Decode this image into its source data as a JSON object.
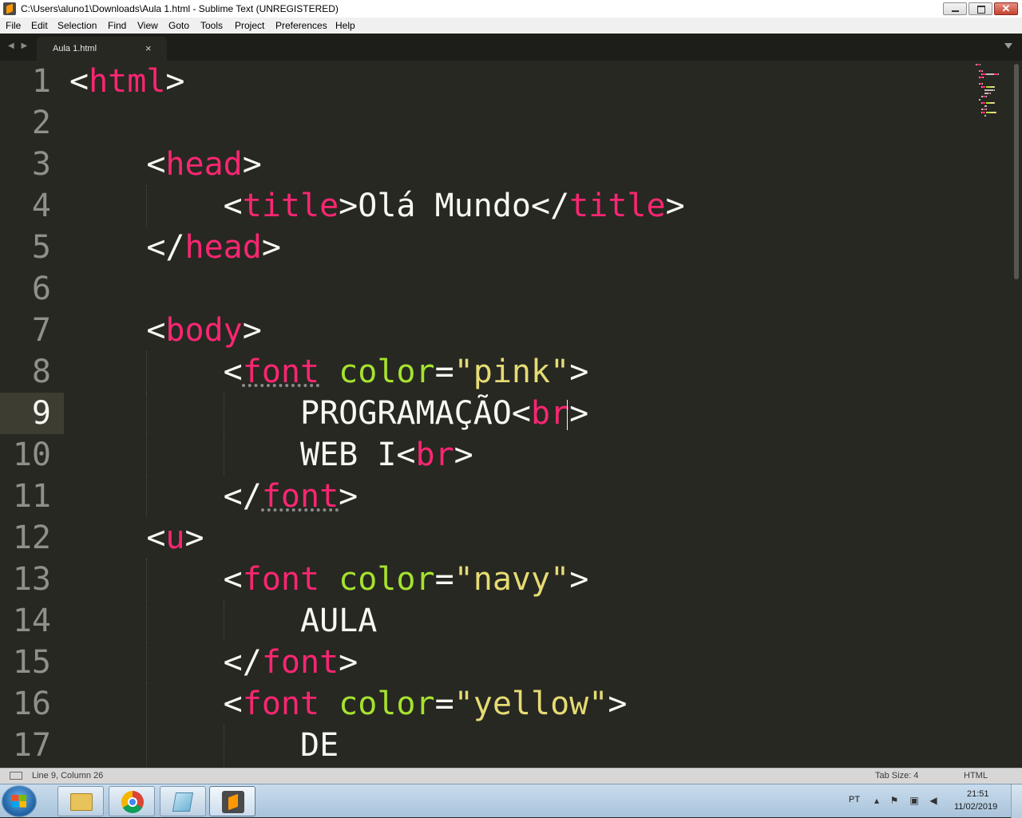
{
  "window": {
    "title": "C:\\Users\\aluno1\\Downloads\\Aula 1.html - Sublime Text (UNREGISTERED)",
    "close_glyph": "✕"
  },
  "menu": [
    "File",
    "Edit",
    "Selection",
    "Find",
    "View",
    "Goto",
    "Tools",
    "Project",
    "Preferences",
    "Help"
  ],
  "tabs": {
    "nav_arrows": "◀ ▶",
    "active": {
      "label": "Aula 1.html",
      "close_glyph": "×"
    }
  },
  "editor": {
    "line_numbers": [
      "1",
      "2",
      "3",
      "4",
      "5",
      "6",
      "7",
      "8",
      "9",
      "10",
      "11",
      "12",
      "13",
      "14",
      "15",
      "16",
      "17"
    ],
    "current_line": 9,
    "colors": {
      "background": "#272822",
      "tag": "#f92672",
      "attribute": "#a6e22e",
      "string": "#e6db74",
      "text": "#f8f8f2",
      "gutter": "#8f908a"
    },
    "lines": [
      [
        {
          "t": "<",
          "c": "p"
        },
        {
          "t": "html",
          "c": "tag"
        },
        {
          "t": ">",
          "c": "p"
        }
      ],
      [],
      [
        {
          "t": "    <",
          "c": "p"
        },
        {
          "t": "head",
          "c": "tag"
        },
        {
          "t": ">",
          "c": "p"
        }
      ],
      [
        {
          "t": "        <",
          "c": "p"
        },
        {
          "t": "title",
          "c": "tag"
        },
        {
          "t": ">Olá Mundo</",
          "c": "p"
        },
        {
          "t": "title",
          "c": "tag"
        },
        {
          "t": ">",
          "c": "p"
        }
      ],
      [
        {
          "t": "    </",
          "c": "p"
        },
        {
          "t": "head",
          "c": "tag"
        },
        {
          "t": ">",
          "c": "p"
        }
      ],
      [],
      [
        {
          "t": "    <",
          "c": "p"
        },
        {
          "t": "body",
          "c": "tag"
        },
        {
          "t": ">",
          "c": "p"
        }
      ],
      [
        {
          "t": "        <",
          "c": "p"
        },
        {
          "t": "font",
          "c": "tag ul"
        },
        {
          "t": " ",
          "c": "p"
        },
        {
          "t": "color",
          "c": "attr"
        },
        {
          "t": "=",
          "c": "p"
        },
        {
          "t": "\"pink\"",
          "c": "str"
        },
        {
          "t": ">",
          "c": "p"
        }
      ],
      [
        {
          "t": "            PROGRAMAÇÃO<",
          "c": "p"
        },
        {
          "t": "br",
          "c": "tag"
        },
        {
          "t": ">",
          "c": "p"
        }
      ],
      [
        {
          "t": "            WEB I<",
          "c": "p"
        },
        {
          "t": "br",
          "c": "tag"
        },
        {
          "t": ">",
          "c": "p"
        }
      ],
      [
        {
          "t": "        </",
          "c": "p"
        },
        {
          "t": "font",
          "c": "tag ul"
        },
        {
          "t": ">",
          "c": "p"
        }
      ],
      [
        {
          "t": "    <",
          "c": "p"
        },
        {
          "t": "u",
          "c": "tag"
        },
        {
          "t": ">",
          "c": "p"
        }
      ],
      [
        {
          "t": "        <",
          "c": "p"
        },
        {
          "t": "font",
          "c": "tag"
        },
        {
          "t": " ",
          "c": "p"
        },
        {
          "t": "color",
          "c": "attr"
        },
        {
          "t": "=",
          "c": "p"
        },
        {
          "t": "\"navy\"",
          "c": "str"
        },
        {
          "t": ">",
          "c": "p"
        }
      ],
      [
        {
          "t": "            AULA",
          "c": "p"
        }
      ],
      [
        {
          "t": "        </",
          "c": "p"
        },
        {
          "t": "font",
          "c": "tag"
        },
        {
          "t": ">",
          "c": "p"
        }
      ],
      [
        {
          "t": "        <",
          "c": "p"
        },
        {
          "t": "font",
          "c": "tag"
        },
        {
          "t": " ",
          "c": "p"
        },
        {
          "t": "color",
          "c": "attr"
        },
        {
          "t": "=",
          "c": "p"
        },
        {
          "t": "\"yellow\"",
          "c": "str"
        },
        {
          "t": ">",
          "c": "p"
        }
      ],
      [
        {
          "t": "            DE",
          "c": "p"
        }
      ]
    ]
  },
  "status": {
    "position": "Line 9, Column 26",
    "tab_size": "Tab Size: 4",
    "syntax": "HTML"
  },
  "taskbar": {
    "apps": [
      {
        "name": "explorer",
        "icon": "folder-icon"
      },
      {
        "name": "chrome",
        "icon": "chrome-icon"
      },
      {
        "name": "notepad",
        "icon": "notepad-icon"
      },
      {
        "name": "sublime",
        "icon": "sublime-text-icon",
        "active": true
      }
    ],
    "tray": {
      "language": "PT",
      "time": "21:51",
      "date": "11/02/2019"
    }
  }
}
